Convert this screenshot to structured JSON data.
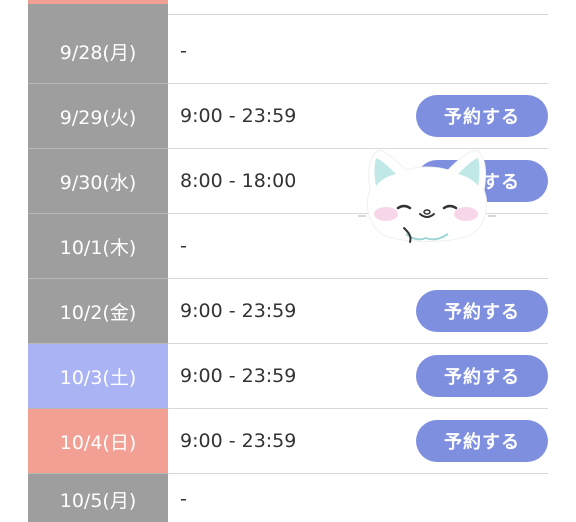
{
  "schedule": {
    "reserve_label": "予約する",
    "rows": [
      {
        "date": "9/28(月)",
        "hours": "-",
        "reservable": false,
        "day_type": "weekday"
      },
      {
        "date": "9/29(火)",
        "hours": "9:00 - 23:59",
        "reservable": true,
        "day_type": "weekday"
      },
      {
        "date": "9/30(水)",
        "hours": "8:00 - 18:00",
        "reservable": true,
        "day_type": "weekday"
      },
      {
        "date": "10/1(木)",
        "hours": "-",
        "reservable": false,
        "day_type": "weekday"
      },
      {
        "date": "10/2(金)",
        "hours": "9:00 - 23:59",
        "reservable": true,
        "day_type": "weekday"
      },
      {
        "date": "10/3(土)",
        "hours": "9:00 - 23:59",
        "reservable": true,
        "day_type": "saturday"
      },
      {
        "date": "10/4(日)",
        "hours": "9:00 - 23:59",
        "reservable": true,
        "day_type": "sunday"
      },
      {
        "date": "10/5(月)",
        "hours": "-",
        "reservable": false,
        "day_type": "weekday"
      }
    ]
  },
  "colors": {
    "weekday": "#9e9e9e",
    "saturday": "#aab4f5",
    "sunday": "#f2a093",
    "button": "#7f8fe0"
  },
  "overlay": {
    "icon": "cat-mascot-icon"
  }
}
